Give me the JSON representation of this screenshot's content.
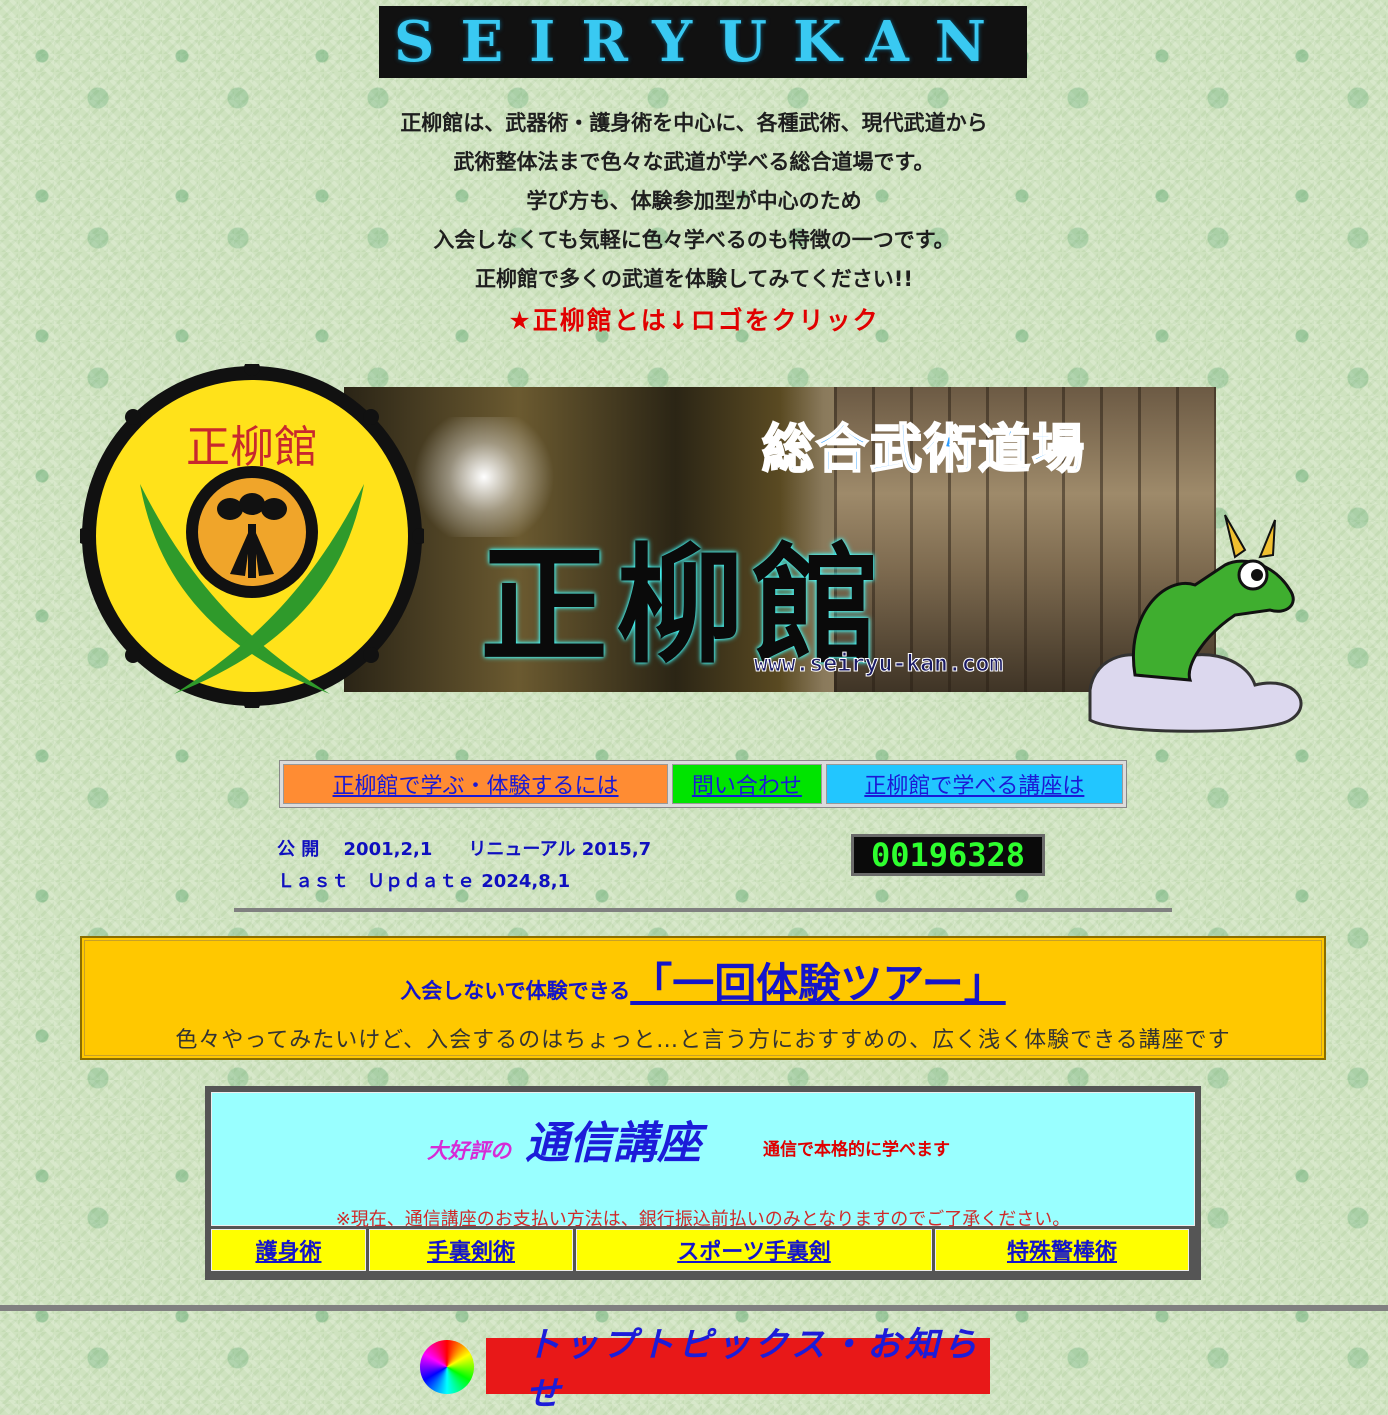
{
  "brand": {
    "title": "SEIRYUKAN"
  },
  "intro": {
    "lines": [
      "正柳館は、武器術・護身術を中心に、各種武術、現代武道から",
      "武術整体法まで色々な武道が学べる総合道場です。",
      "学び方も、体験参加型が中心のため",
      "入会しなくても気軽に色々学べるのも特徴の一つです。",
      "正柳館で多くの武道を体験してみてください!!"
    ],
    "cta": "★正柳館とは↓ロゴをクリック"
  },
  "crest": {
    "text": "正柳館"
  },
  "hero": {
    "subtitle": "総合武術道場",
    "title": "正柳館",
    "url": "www.seiryu-kan.com"
  },
  "nav": [
    {
      "label": "正柳館で学ぶ・体験するには",
      "color": "#ff8c33"
    },
    {
      "label": "問い合わせ",
      "color": "#00e400"
    },
    {
      "label": "正柳館で学べる講座は",
      "color": "#22c6ff"
    }
  ],
  "info": {
    "open": "公 開　 2001,2,1　　リニューアル 2015,7",
    "update": "Ｌａｓｔ　Ｕｐｄａｔｅ 2024,8,1",
    "counter": "00196328"
  },
  "tour": {
    "prefix": "入会しないで体験できる",
    "title": "「一回体験ツアー」",
    "desc": "色々やってみたいけど、入会するのはちょっと…と言う方におすすめの、広く浅く体験できる講座です"
  },
  "course": {
    "lead": "大好評の",
    "title": "通信講座",
    "tag": "通信で本格的に学べます",
    "note": "※現在、通信講座のお支払い方法は、銀行振込前払いのみとなりますのでご了承ください。",
    "items": [
      "護身術",
      "手裏剣術",
      "スポーツ手裏剣",
      "特殊警棒術"
    ]
  },
  "topics": {
    "label": "トップトピックス・お知らせ"
  }
}
